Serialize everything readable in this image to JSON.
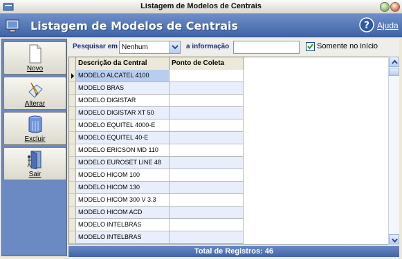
{
  "window": {
    "title": "Listagem de Modelos de Centrais"
  },
  "header": {
    "title": "Listagem de Modelos de Centrais",
    "help_label": "Ajuda"
  },
  "sidebar": {
    "items": [
      {
        "label": "Novo",
        "icon": "new-document-icon"
      },
      {
        "label": "Alterar",
        "icon": "edit-icon"
      },
      {
        "label": "Excluir",
        "icon": "trash-icon"
      },
      {
        "label": "Sair",
        "icon": "exit-door-icon"
      }
    ]
  },
  "search": {
    "label_search_in": "Pesquisar em",
    "field_value": "Nenhum",
    "label_info": "a informação",
    "info_value": "",
    "only_start_label": "Somente no início",
    "only_start_checked": true
  },
  "table": {
    "columns": [
      "Descrição da Central",
      "Ponto de Coleta"
    ],
    "rows": [
      {
        "descricao": "MODELO ALCATEL 4100",
        "ponto": ""
      },
      {
        "descricao": "MODELO BRAS",
        "ponto": ""
      },
      {
        "descricao": "MODELO DIGISTAR",
        "ponto": ""
      },
      {
        "descricao": "MODELO DIGISTAR XT 50",
        "ponto": ""
      },
      {
        "descricao": "MODELO EQUITEL 4000-E",
        "ponto": ""
      },
      {
        "descricao": "MODELO EQUITEL 40-E",
        "ponto": ""
      },
      {
        "descricao": "MODELO ERICSON MD 110",
        "ponto": ""
      },
      {
        "descricao": "MODELO EUROSET LINE 48",
        "ponto": ""
      },
      {
        "descricao": "MODELO HICOM 100",
        "ponto": ""
      },
      {
        "descricao": "MODELO HICOM 130",
        "ponto": ""
      },
      {
        "descricao": "MODELO HICOM 300 V 3.3",
        "ponto": ""
      },
      {
        "descricao": "MODELO HICOM ACD",
        "ponto": ""
      },
      {
        "descricao": "MODELO INTELBRAS",
        "ponto": ""
      },
      {
        "descricao": "MODELO INTELBRAS",
        "ponto": ""
      }
    ]
  },
  "status": {
    "total_text": "Total de Registros: 46"
  },
  "colors": {
    "accent": "#4a6fb3",
    "header_bg": "#5577b8",
    "row_alt": "#e8eefb"
  }
}
